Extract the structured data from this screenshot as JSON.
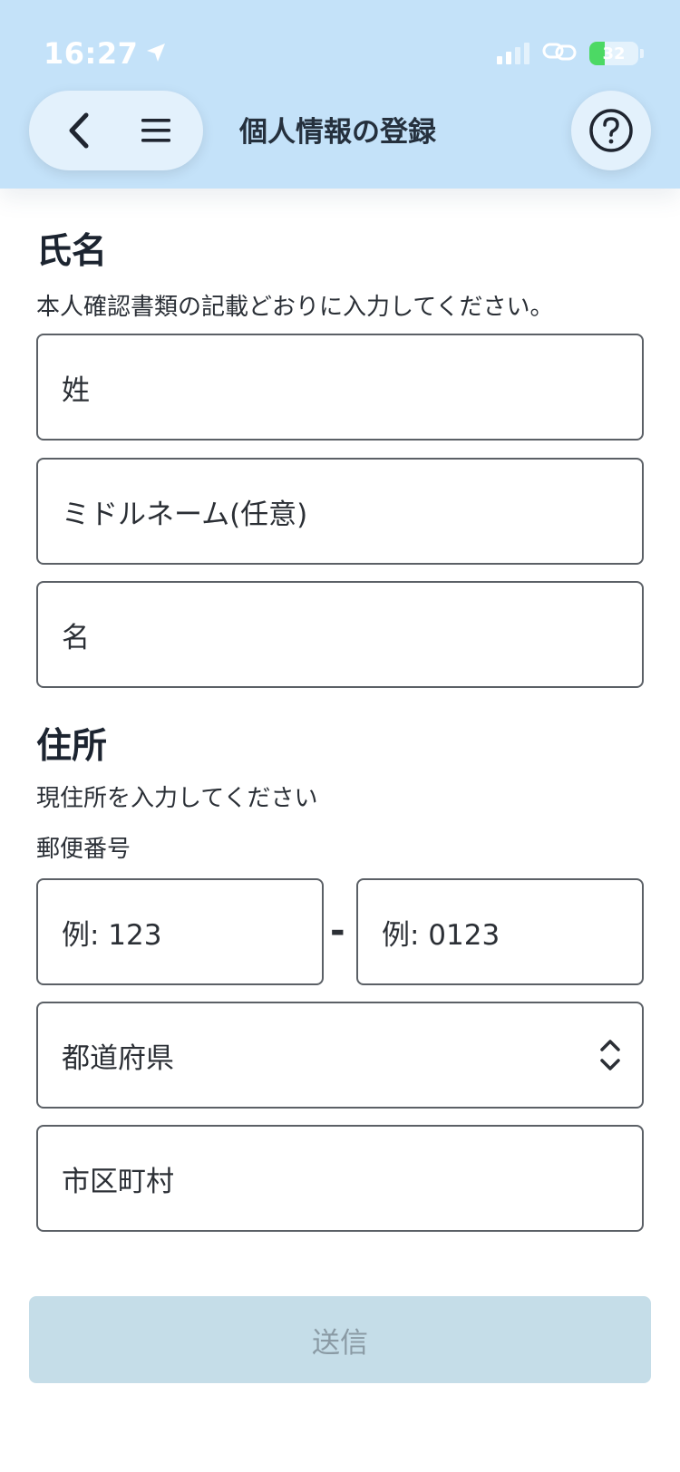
{
  "status_bar": {
    "time": "16:27",
    "battery": "32",
    "battery_level": 0.32
  },
  "header": {
    "title": "個人情報の登録"
  },
  "name_section": {
    "title": "氏名",
    "description": "本人確認書類の記載どおりに入力してください。",
    "last_name_placeholder": "姓",
    "middle_name_placeholder": "ミドルネーム(任意)",
    "first_name_placeholder": "名"
  },
  "address_section": {
    "title": "住所",
    "description": "現住所を入力してください",
    "postal_label": "郵便番号",
    "postal_first_placeholder": "例: 123",
    "postal_separator": "-",
    "postal_second_placeholder": "例: 0123",
    "prefecture_placeholder": "都道府県",
    "city_placeholder": "市区町村"
  },
  "submit_label": "送信",
  "colors": {
    "header_bg": "#c4e2f9",
    "submit_disabled_bg": "#c5dde8",
    "battery_green": "#4cd964"
  }
}
